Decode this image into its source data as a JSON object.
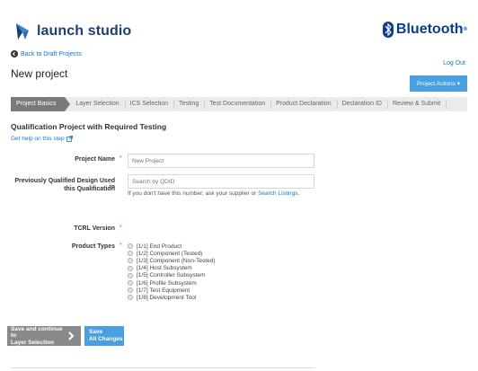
{
  "brand": {
    "name": "launch studio",
    "partner": "Bluetooth",
    "partner_mark": "®"
  },
  "nav": {
    "back_label": "Back to Draft Projects",
    "logout_label": "Log Out"
  },
  "page": {
    "title": "New project",
    "actions_label": "Project Actions ▾"
  },
  "tabs": [
    {
      "label": "Project Basics",
      "active": true
    },
    {
      "label": "Layer Selection"
    },
    {
      "label": "ICS Selection"
    },
    {
      "label": "Testing"
    },
    {
      "label": "Test Documentation"
    },
    {
      "label": "Product Declaration"
    },
    {
      "label": "Declaration ID"
    },
    {
      "label": "Review & Submit"
    }
  ],
  "section": {
    "title": "Qualification Project with Required Testing",
    "help_label": "Get help on this step"
  },
  "form": {
    "project_name": {
      "label": "Project Name",
      "placeholder": "New Project",
      "required": "*"
    },
    "qdid": {
      "label_line1": "Previously Qualified Design Used in",
      "label_line2": "this Qualification",
      "placeholder": "Search by QDID",
      "hint_prefix": "If you don't have this number, ask your supplier or",
      "hint_link": "Search Listings",
      "hint_suffix": "."
    },
    "tcrl": {
      "label": "TCRL Version",
      "required": "*"
    },
    "product_types": {
      "label": "Product Types",
      "required": "*",
      "options": [
        "[1/1] End Product",
        "[1/2] Component (Tested)",
        "[1/3] Component (Non-Tested)",
        "[1/4] Host Subsystem",
        "[1/5] Controller Subsystem",
        "[1/6] Profile Subsystem",
        "[1/7] Test Equipment",
        "[1/8] Development Tool"
      ]
    }
  },
  "buttons": {
    "continue_line1": "Save and continue to",
    "continue_line2": "Layer Selection",
    "save_line1": "Save",
    "save_line2": "All Changes"
  },
  "colors": {
    "accent": "#4a9fe0",
    "link": "#1a73c9",
    "brand": "#1d3f6e",
    "required": "#d9534f"
  }
}
